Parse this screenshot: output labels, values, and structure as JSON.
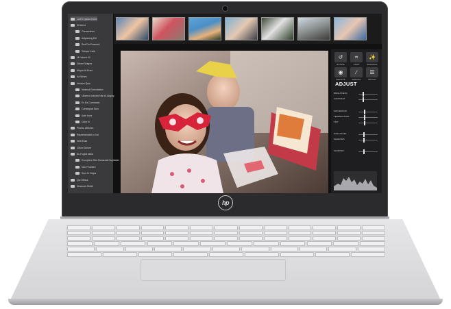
{
  "device": {
    "brand_logo": "hp"
  },
  "sidebar": {
    "items": [
      {
        "label": "Lorem Ipsum Dolor",
        "level": 0
      },
      {
        "label": "Sit Amet",
        "level": 0
      },
      {
        "label": "Consectetur",
        "level": 1
      },
      {
        "label": "Adipiscing Elit",
        "level": 1
      },
      {
        "label": "Sed Do Eiusmod",
        "level": 1
      },
      {
        "label": "Tempor Incid",
        "level": 1
      },
      {
        "label": "Ut Labore Et",
        "level": 0
      },
      {
        "label": "Dolore Magna",
        "level": 0
      },
      {
        "label": "Aliqua Ut Enim",
        "level": 0
      },
      {
        "label": "Ad Minim",
        "level": 0
      },
      {
        "label": "Veniam Quis",
        "level": 0
      },
      {
        "label": "Nostrud Exercitation",
        "level": 1
      },
      {
        "label": "Ullamco Laboris Nisi Ut Aliquip",
        "level": 1
      },
      {
        "label": "Ex Ea Commodo",
        "level": 1
      },
      {
        "label": "Consequat Duis",
        "level": 1
      },
      {
        "label": "Aute Irure",
        "level": 1
      },
      {
        "label": "Dolor In",
        "level": 1
      },
      {
        "label": "Photos Ultricies",
        "level": 0
      },
      {
        "label": "Reprehenderit In Vol",
        "level": 0
      },
      {
        "label": "Velit Esse",
        "level": 0
      },
      {
        "label": "Cillum Dolore",
        "level": 0
      },
      {
        "label": "Eu Fugiat Nulla",
        "level": 0
      },
      {
        "label": "Excepteur Sint Occaecat Cupidatat",
        "level": 1
      },
      {
        "label": "Non Proident",
        "level": 1
      },
      {
        "label": "Sunt In Culpa",
        "level": 1
      },
      {
        "label": "Qui Officia",
        "level": 0
      },
      {
        "label": "Deserunt Mollit",
        "level": 0
      }
    ]
  },
  "toolbar": {
    "tools": [
      {
        "icon": "rotate-icon",
        "label": "ROTATE"
      },
      {
        "icon": "crop-icon",
        "label": "CROP"
      },
      {
        "icon": "enhance-icon",
        "label": "ENHANCE"
      },
      {
        "icon": "redeye-icon",
        "label": "RED EYE"
      },
      {
        "icon": "smooth-icon",
        "label": "SMOOTH"
      },
      {
        "icon": "adjust-icon",
        "label": "ADJUST"
      }
    ]
  },
  "adjust": {
    "title": "ADJUST",
    "sliders": [
      {
        "label": "BRIGHTNESS",
        "value": 0.2
      },
      {
        "label": "CONTRAST",
        "value": 0.2
      },
      {
        "label": "SATURATION",
        "value": 0.3
      },
      {
        "label": "TEMPERATURE",
        "value": 0.3
      },
      {
        "label": "TINT",
        "value": 0.3
      },
      {
        "label": "HIGHLIGHTS",
        "value": 0.25
      },
      {
        "label": "SHADOWS",
        "value": 0.25
      },
      {
        "label": "SHARPEN",
        "value": 0.25
      }
    ]
  },
  "colors": {
    "lid": "#2b2b2d",
    "panel": "#1e1e20",
    "body_silver": "#dadadd",
    "mask_red": "#d8243a"
  }
}
